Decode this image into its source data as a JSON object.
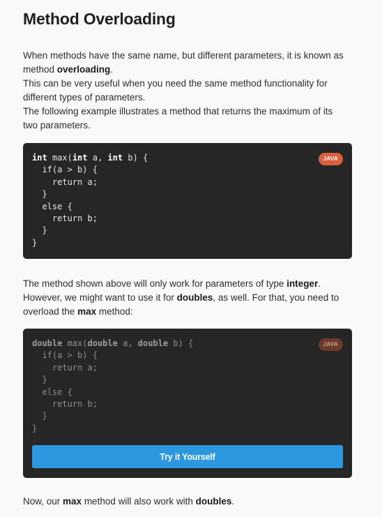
{
  "page": {
    "title": "Method Overloading"
  },
  "intro": {
    "l1": "When methods have the same name, but different parameters, it is known as",
    "l2_a": "method ",
    "l2_b": "overloading",
    "l2_c": ".",
    "l3": "This can be very useful when you need the same method functionality for",
    "l4": "different types of parameters.",
    "l5": "The following example illustrates a method that returns the maximum of its",
    "l6": "two parameters."
  },
  "code1": {
    "badge": "JAVA",
    "kw_int": "int",
    "name": " max(",
    "sep": " a, ",
    "close_sig": " b) {",
    "line2": "  if(a > b) {",
    "line3": "    return a;",
    "line4": "  }",
    "line5": "  else {",
    "line6": "    return b;",
    "line7": "  }",
    "line8": "}"
  },
  "middle": {
    "l1_a": "The method shown above will only work for parameters of type ",
    "l1_b": "integer",
    "l1_c": ".",
    "l2_a": "However, we might want to use it for ",
    "l2_b": "doubles",
    "l2_c": ", as well. For that, you need to",
    "l3_a": "overload the ",
    "l3_b": "max",
    "l3_c": " method:"
  },
  "code2": {
    "badge": "JAVA",
    "kw_double": "double",
    "name": " max(",
    "sep": " a, ",
    "close_sig": " b) {",
    "line2": "  if(a > b) {",
    "line3": "    return a;",
    "line4": "  }",
    "line5": "  else {",
    "line6": "    return b;",
    "line7": "  }",
    "line8": "}",
    "button_label": "Try it Yourself"
  },
  "outro": {
    "l1_a": "Now, our ",
    "l1_b": "max",
    "l1_c": " method will also work with ",
    "l1_d": "doubles",
    "l1_e": "."
  },
  "colors": {
    "accent": "#2c98df",
    "badge": "#d9603b",
    "code_bg": "#262626"
  }
}
